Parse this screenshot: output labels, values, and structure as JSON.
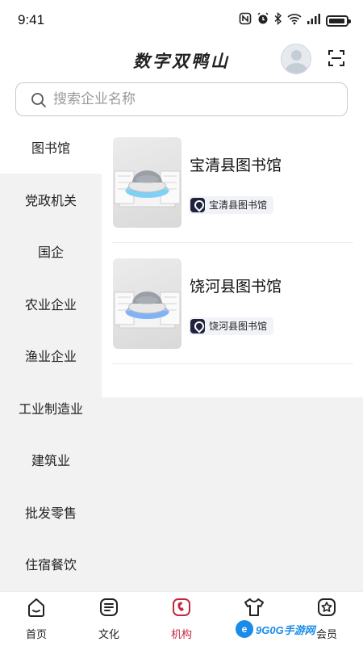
{
  "status_bar": {
    "time": "9:41",
    "icons": [
      "nfc-icon",
      "alarm-icon",
      "bluetooth-icon",
      "wifi-icon",
      "signal-icon",
      "battery-icon"
    ]
  },
  "header": {
    "title": "数字双鸭山",
    "avatar_icon": "user-avatar-icon",
    "scan_icon": "scan-icon"
  },
  "search": {
    "placeholder": "搜索企业名称",
    "value": ""
  },
  "sidebar": {
    "items": [
      {
        "label": "图书馆",
        "active": true
      },
      {
        "label": "党政机关",
        "active": false
      },
      {
        "label": "国企",
        "active": false
      },
      {
        "label": "农业企业",
        "active": false
      },
      {
        "label": "渔业企业",
        "active": false
      },
      {
        "label": "工业制造业",
        "active": false
      },
      {
        "label": "建筑业",
        "active": false
      },
      {
        "label": "批发零售",
        "active": false
      },
      {
        "label": "住宿餐饮",
        "active": false
      }
    ]
  },
  "content": {
    "items": [
      {
        "title": "宝清县图书馆",
        "tag": "宝清县图书馆",
        "tag_icon": "location-pin-icon"
      },
      {
        "title": "饶河县图书馆",
        "tag": "饶河县图书馆",
        "tag_icon": "location-pin-icon"
      }
    ]
  },
  "bottom_nav": {
    "items": [
      {
        "label": "首页",
        "icon": "home-icon",
        "active": false
      },
      {
        "label": "文化",
        "icon": "culture-icon",
        "active": false
      },
      {
        "label": "机构",
        "icon": "institution-icon",
        "active": true
      },
      {
        "label": "",
        "icon": "apparel-icon",
        "active": false
      },
      {
        "label": "会员",
        "icon": "member-icon",
        "active": false
      }
    ]
  },
  "watermark": {
    "logo": "e",
    "text": "9G0G手游网"
  },
  "colors": {
    "accent": "#c4263e",
    "tag_bg": "#f1f3f8",
    "tag_icon_bg": "#1f2340",
    "sidebar_bg": "#f2f2f2"
  }
}
